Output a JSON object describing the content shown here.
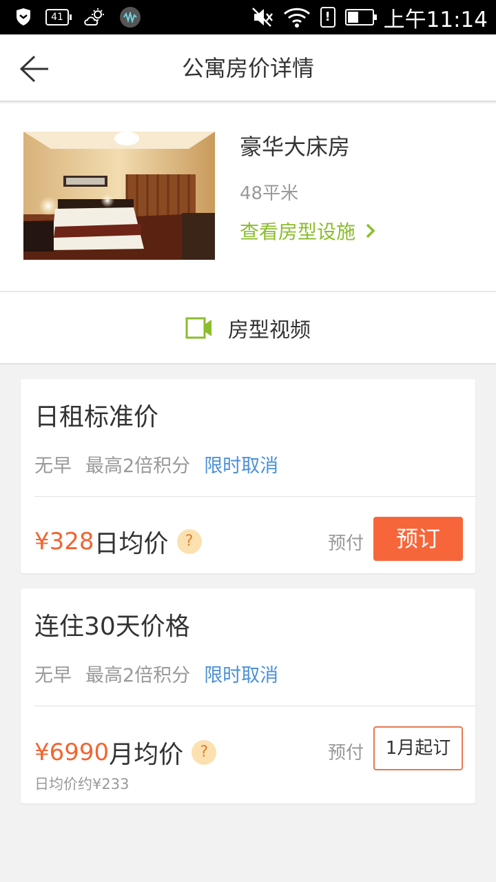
{
  "status_bar": {
    "time": "上午11:14",
    "badge": "41",
    "alert": "!",
    "battery_level": 0.45
  },
  "header": {
    "title": "公寓房价详情"
  },
  "room": {
    "name": "豪华大床房",
    "area": "48平米",
    "facility_link": "查看房型设施"
  },
  "video": {
    "label": "房型视频"
  },
  "plans": [
    {
      "title": "日租标准价",
      "tags": [
        "无早",
        "最高2倍积分"
      ],
      "cancel_tag": "限时取消",
      "price": "¥328",
      "unit": "日均价",
      "help": "?",
      "prepay": "预付",
      "button": "预订"
    },
    {
      "title": "连住30天价格",
      "tags": [
        "无早",
        "最高2倍积分"
      ],
      "cancel_tag": "限时取消",
      "price": "¥6990",
      "unit": "月均价",
      "help": "?",
      "prepay": "预付",
      "button": "1月起订",
      "daily_avg": "日均价约¥233"
    }
  ],
  "colors": {
    "accent_orange": "#f7663a",
    "price_orange": "#f26430",
    "link_green": "#8bbd2c",
    "tag_blue": "#4a90d9"
  }
}
